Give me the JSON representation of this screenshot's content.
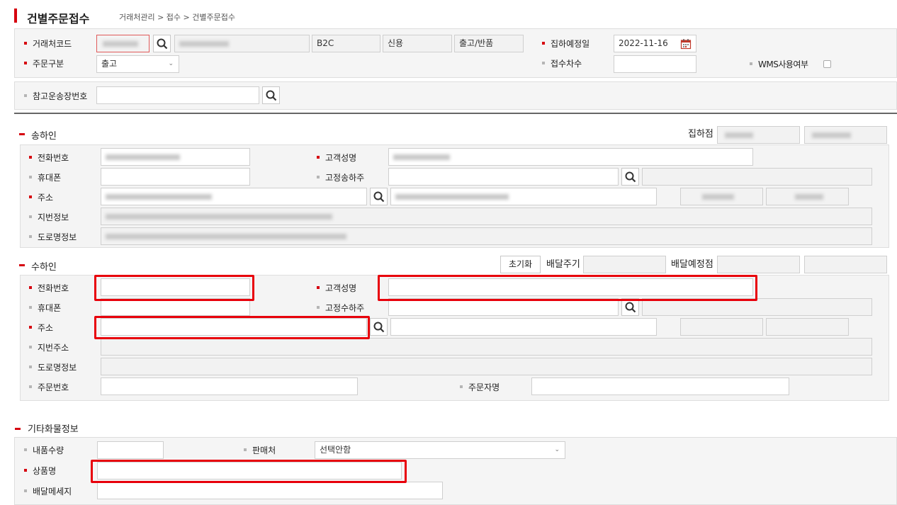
{
  "page": {
    "title": "건별주문접수",
    "breadcrumb": "거래처관리 > 접수 > 건별주문접수",
    "accent": "#d6000f"
  },
  "top": {
    "client_code_label": "거래처코드",
    "client_type": "B2C",
    "payment": "신용",
    "direction": "출고/반품",
    "pickup_date_label": "집하예정일",
    "pickup_date": "2022-11-16",
    "order_type_label": "주문구분",
    "order_type": "출고",
    "receipt_no_label": "접수차수",
    "wms_label": "WMS사용여부",
    "ref_invoice_label": "참고운송장번호"
  },
  "sender": {
    "title": "송하인",
    "pickup_point_label": "집하점",
    "phone_label": "전화번호",
    "customer_name_label": "고객성명",
    "mobile_label": "휴대폰",
    "fixed_shipper_label": "고정송하주",
    "address_label": "주소",
    "jibun_label": "지번정보",
    "road_label": "도로명정보"
  },
  "receiver": {
    "title": "수하인",
    "reset_label": "초기화",
    "delivery_cycle_label": "배달주기",
    "delivery_point_label": "배달예정점",
    "phone_label": "전화번호",
    "customer_name_label": "고객성명",
    "mobile_label": "휴대폰",
    "fixed_receiver_label": "고정수하주",
    "address_label": "주소",
    "jibun_label": "지번주소",
    "road_label": "도로명정보",
    "order_no_label": "주문번호",
    "orderer_label": "주문자명"
  },
  "etc": {
    "title": "기타화물정보",
    "qty_label": "내품수량",
    "seller_label": "판매처",
    "seller_value": "선택안함",
    "product_label": "상품명",
    "message_label": "배달메세지"
  },
  "icons": {
    "search": "search-icon",
    "calendar": "calendar-icon",
    "chevron": "chevron-down-icon",
    "checkbox": "checkbox"
  }
}
